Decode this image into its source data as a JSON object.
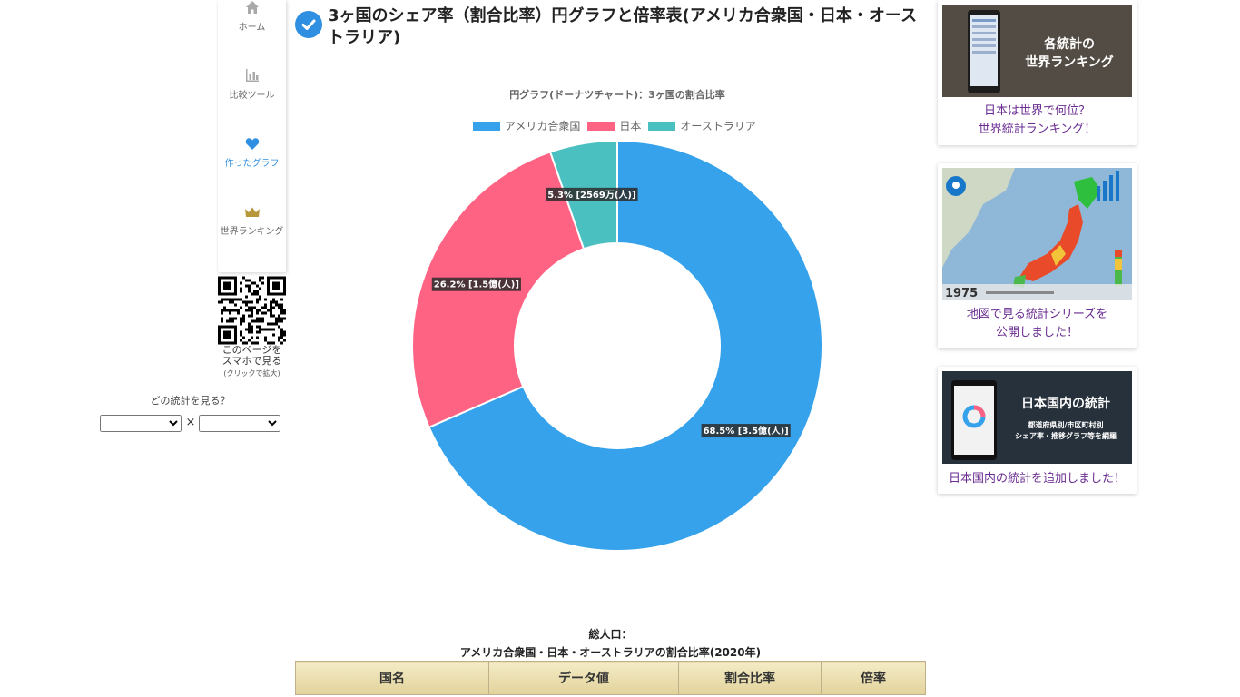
{
  "nav": {
    "items": [
      {
        "label": "ホーム"
      },
      {
        "label": "比較ツール"
      },
      {
        "label": "作ったグラフ"
      },
      {
        "label": "世界ランキング"
      }
    ]
  },
  "qr": {
    "line1": "このページを",
    "line2": "スマホで見る",
    "sub": "(クリックで拡大)"
  },
  "stat_select": {
    "label": "どの統計を見る？",
    "separator": "×"
  },
  "page": {
    "title": "3ヶ国のシェア率（割合比率）円グラフと倍率表(アメリカ合衆国・日本・オーストラリア)"
  },
  "chart_data": {
    "type": "pie",
    "title": "円グラフ(ドーナツチャート)：3ヶ国の割合比率",
    "categories": [
      "アメリカ合衆国",
      "日本",
      "オーストラリア"
    ],
    "values": [
      68.5,
      26.2,
      5.3
    ],
    "labels": [
      "68.5% [3.5億(人)]",
      "26.2% [1.5億(人)]",
      "5.3% [2569万(人)]"
    ],
    "colors": [
      "#36a2eb",
      "#ff6384",
      "#4bc0c0"
    ],
    "legend": "top"
  },
  "table": {
    "caption_line1": "総人口：",
    "caption_line2": "アメリカ合衆国・日本・オーストラリアの割合比率(2020年)",
    "headers": [
      "国名",
      "データ値",
      "割合比率",
      "倍率"
    ]
  },
  "banners": [
    {
      "image_text": [
        "各統計の",
        "世界ランキング"
      ],
      "caption": [
        "日本は世界で何位？",
        "世界統計ランキング！"
      ]
    },
    {
      "image_text": [
        "1975"
      ],
      "caption": [
        "地図で見る統計シリーズを",
        "公開しました！"
      ]
    },
    {
      "image_text": [
        "日本国内の統計",
        "都道府県別/市区町村別",
        "シェア率・推移グラフ等を網羅"
      ],
      "caption": [
        "日本国内の統計を追加しました！"
      ]
    }
  ]
}
